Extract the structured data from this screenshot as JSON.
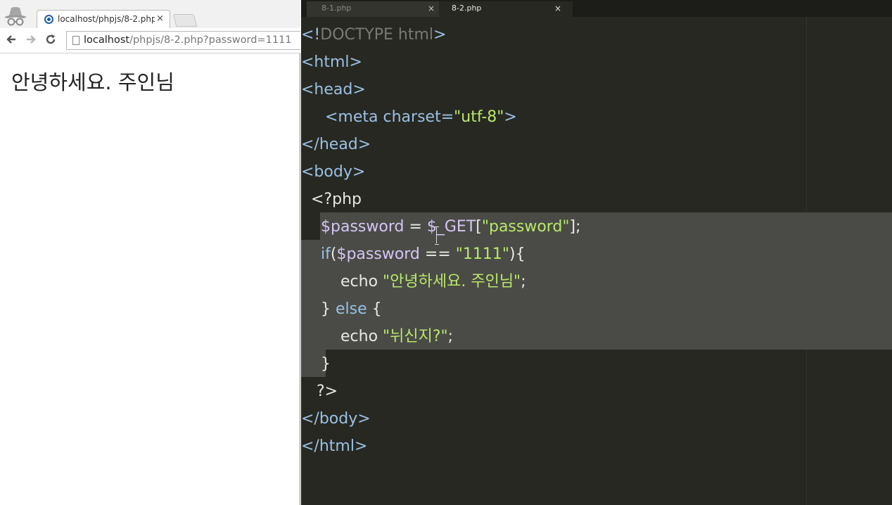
{
  "browser": {
    "tab_title": "localhost/phpjs/8-2.php?",
    "tab_close": "×",
    "url_host": "localhost",
    "url_path": "/phpjs/8-2.php?password=1111",
    "page_text": "안녕하세요. 주인님",
    "back_icon": "arrow-left",
    "forward_icon": "arrow-right",
    "reload_icon": "reload"
  },
  "editor": {
    "tabs": [
      {
        "label": "8-1.php",
        "close": "×"
      },
      {
        "label": "8-2.php",
        "close": "×"
      }
    ],
    "colors": {
      "background": "#272822",
      "tag": "#9bc0e3",
      "string": "#b9e86a",
      "variable": "#d6c5f6",
      "selection": "#4a4b46"
    },
    "code": {
      "l1_open": "<!",
      "l1_doctype": "DOCTYPE html",
      "l1_close": ">",
      "l2": "<html>",
      "l3": "<head>",
      "l4_tag": "<meta charset=",
      "l4_str": "\"utf-8\"",
      "l4_close": ">",
      "l5": "</head>",
      "l6": "<body>",
      "l7": "<?php",
      "l8_var": "$password",
      "l8_op": " = ",
      "l8_get": "$_GET",
      "l8_br1": "[",
      "l8_str": "\"password\"",
      "l8_br2": "];",
      "l9_kw": "if",
      "l9_paren": "(",
      "l9_var": "$password",
      "l9_op": " == ",
      "l9_str": "\"1111\"",
      "l9_end": "){",
      "l10_kw": "echo ",
      "l10_str": "\"안녕하세요. 주인님\"",
      "l10_end": ";",
      "l11_brace": "} ",
      "l11_kw": "else",
      "l11_open": " {",
      "l12_kw": "echo ",
      "l12_str": "\"뉘신지?\"",
      "l12_end": ";",
      "l13": "}",
      "l14": "?>",
      "l15": "</body>",
      "l16": "</html>"
    }
  }
}
